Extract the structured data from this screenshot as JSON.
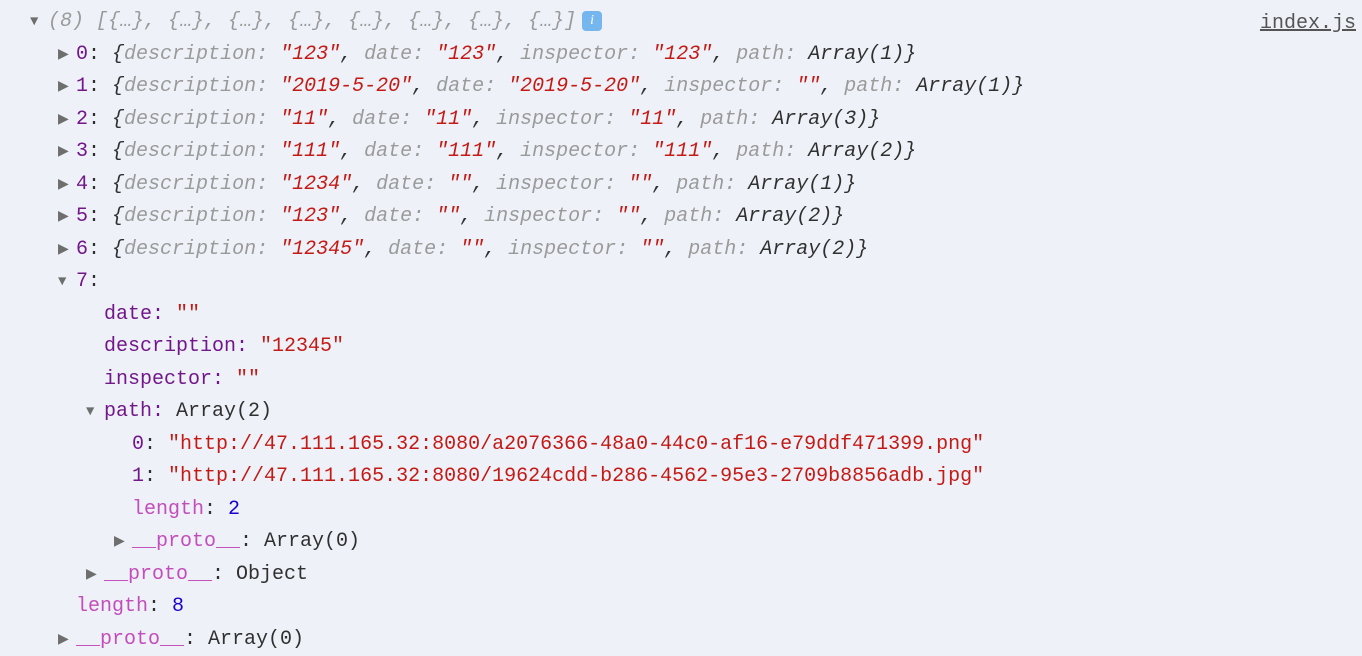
{
  "source_file": "index.js",
  "header": {
    "arrow": "▼",
    "count_label": "(8)",
    "preview": "[{…}, {…}, {…}, {…}, {…}, {…}, {…}, {…}]",
    "info_glyph": "i"
  },
  "collapsed": [
    {
      "idx": "0",
      "description": "\"123\"",
      "date": "\"123\"",
      "inspector": "\"123\"",
      "path_repr": "Array(1)"
    },
    {
      "idx": "1",
      "description": "\"2019-5-20\"",
      "date": "\"2019-5-20\"",
      "inspector": "\"\"",
      "path_repr": "Array(1)"
    },
    {
      "idx": "2",
      "description": "\"11\"",
      "date": "\"11\"",
      "inspector": "\"11\"",
      "path_repr": "Array(3)"
    },
    {
      "idx": "3",
      "description": "\"111\"",
      "date": "\"111\"",
      "inspector": "\"111\"",
      "path_repr": "Array(2)"
    },
    {
      "idx": "4",
      "description": "\"1234\"",
      "date": "\"\"",
      "inspector": "\"\"",
      "path_repr": "Array(1)"
    },
    {
      "idx": "5",
      "description": "\"123\"",
      "date": "\"\"",
      "inspector": "\"\"",
      "path_repr": "Array(2)"
    },
    {
      "idx": "6",
      "description": "\"12345\"",
      "date": "\"\"",
      "inspector": "\"\"",
      "path_repr": "Array(2)"
    }
  ],
  "expanded": {
    "idx": "7",
    "date": "\"\"",
    "description": "\"12345\"",
    "inspector": "\"\"",
    "path_label": "path: ",
    "path_repr": "Array(2)",
    "path_items": [
      {
        "idx": "0",
        "val": "\"http://47.111.165.32:8080/a2076366-48a0-44c0-af16-e79ddf471399.png\""
      },
      {
        "idx": "1",
        "val": "\"http://47.111.165.32:8080/19624cdd-b286-4562-95e3-2709b8856adb.jpg\""
      }
    ],
    "path_length_key": "length",
    "path_length_val": "2",
    "path_proto_key": "__proto__",
    "path_proto_val": "Array(0)",
    "obj_proto_key": "__proto__",
    "obj_proto_val": "Object"
  },
  "footer": {
    "length_key": "length",
    "length_val": "8",
    "proto_key": "__proto__",
    "proto_val": "Array(0)"
  },
  "labels": {
    "description": "description: ",
    "date": "date: ",
    "inspector": "inspector: ",
    "path": "path: ",
    "colon": ": "
  },
  "arrows": {
    "right": "▶",
    "down": "▼"
  }
}
